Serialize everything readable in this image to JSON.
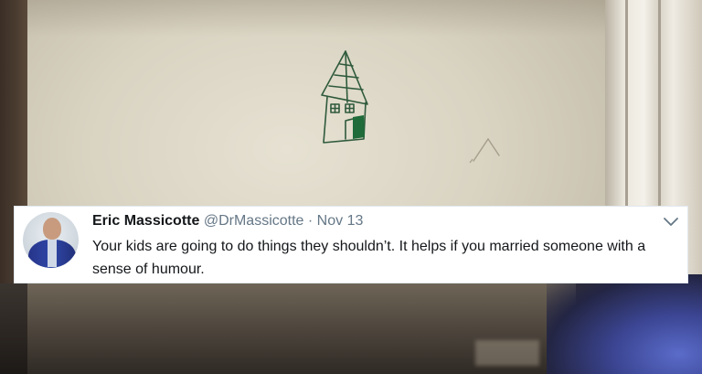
{
  "tweet": {
    "display_name": "Eric Massicotte",
    "handle": "@DrMassicotte",
    "separator": "·",
    "date": "Nov 13",
    "text": "Your kids are going to do things they shouldn’t. It helps if you married someone with a sense of humour.",
    "menu_icon": "chevron-down-icon"
  },
  "colors": {
    "name": "#14171a",
    "secondary": "#657786",
    "card_bg": "#ffffff",
    "drawing_marker": "#1f6b3a"
  }
}
